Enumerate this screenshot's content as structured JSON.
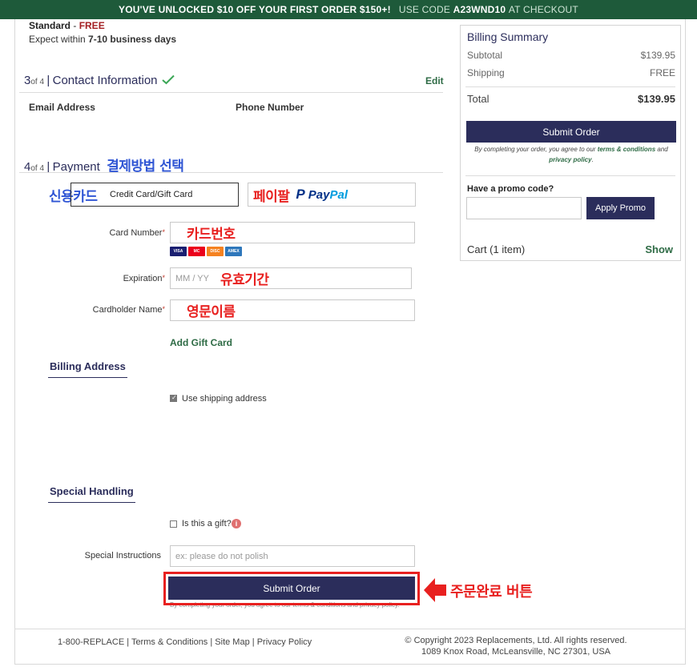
{
  "banner": {
    "main": "YOU'VE UNLOCKED $10 OFF YOUR FIRST ORDER $150+!",
    "code_prefix": "USE CODE",
    "code": "A23WND10",
    "code_suffix": "AT CHECKOUT"
  },
  "shipping": {
    "method": "Standard",
    "dash": " - ",
    "price": "FREE",
    "expect_prefix": "Expect within ",
    "expect_days": "7-10 business days"
  },
  "contact": {
    "step_num": "3",
    "step_of": "of 4",
    "sep": "|",
    "title": "Contact Information",
    "edit": "Edit",
    "email_label": "Email Address",
    "phone_label": "Phone Number"
  },
  "payment": {
    "step_num": "4",
    "step_of": "of 4",
    "sep": "|",
    "title": "Payment",
    "annotation": "결제방법 선택",
    "credit_annotation": "신용카드",
    "credit_label": "Credit Card/Gift Card",
    "paypal_annotation": "페이팔",
    "paypal_p": "P",
    "paypal_pay": "Pay",
    "paypal_pal": "Pal",
    "card_number_label": "Card Number",
    "card_number_annotation": "카드번호",
    "card_logos": [
      "VISA",
      "MC",
      "DISC",
      "AMEX"
    ],
    "expiration_label": "Expiration",
    "expiration_placeholder": "MM / YY",
    "expiration_annotation": "유효기간",
    "cardholder_label": "Cardholder Name",
    "cardholder_annotation": "영문이름",
    "required_mark": "*",
    "add_gift_card": "Add Gift Card"
  },
  "billing": {
    "heading": "Billing Address",
    "use_shipping_label": "Use shipping address",
    "use_shipping_checked": true
  },
  "special": {
    "heading": "Special Handling",
    "gift_label": "Is this a gift?",
    "gift_checked": false,
    "info_icon": "i",
    "instructions_label": "Special Instructions",
    "instructions_placeholder": "ex: please do not polish"
  },
  "bottom_submit": {
    "label": "Submit Order",
    "terms_obscured": "By completing your order, you agree to our terms & conditions and privacy policy.",
    "annotation": "주문완료 버튼"
  },
  "summary": {
    "title": "Billing Summary",
    "subtotal_label": "Subtotal",
    "subtotal_value": "$139.95",
    "shipping_label": "Shipping",
    "shipping_value": "FREE",
    "total_label": "Total",
    "total_value": "$139.95",
    "submit_label": "Submit Order",
    "terms_1": "By completing your order, you agree to our ",
    "terms_link": "terms & conditions",
    "terms_2": " and",
    "privacy_link": "privacy policy",
    "terms_end": ".",
    "promo_label": "Have a promo code?",
    "apply_label": "Apply Promo",
    "cart_label": "Cart (1 item)",
    "show_label": "Show"
  },
  "footer": {
    "phone": "1-800-REPLACE",
    "sep": " | ",
    "terms": "Terms & Conditions",
    "sitemap": "Site Map",
    "privacy": "Privacy Policy",
    "copyright": "© Copyright 2023 Replacements, Ltd. All rights reserved.",
    "address": "1089 Knox Road, McLeansville, NC 27301, USA"
  },
  "colors": {
    "banner_green": "#1e5a3a",
    "navy": "#2b2d5b",
    "link_green": "#2e6b45",
    "annotation_red": "#e8201f",
    "annotation_blue": "#2f55d4",
    "paypal_dark": "#003087",
    "paypal_light": "#009cde"
  }
}
